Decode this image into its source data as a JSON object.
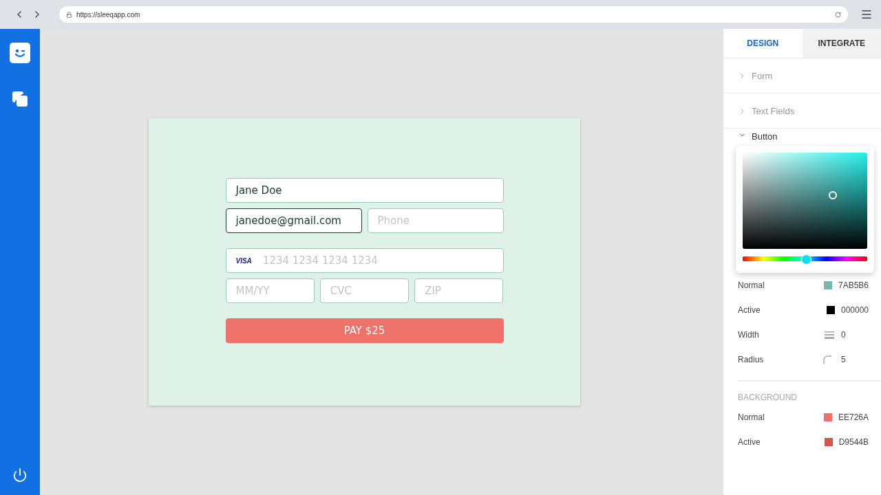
{
  "browser": {
    "url": "https://sleeqapp.com"
  },
  "form": {
    "rows": [
      [
        {
          "kind": "text",
          "value": "Jane Doe",
          "focused": false
        }
      ],
      [
        {
          "kind": "text",
          "value": "janedoe@gmail.com",
          "focused": true
        },
        {
          "kind": "text",
          "placeholder": "Phone",
          "focused": false
        }
      ],
      [
        {
          "kind": "card",
          "brand": "VISA",
          "placeholder": "1234 1234 1234 1234",
          "focused": false
        }
      ],
      [
        {
          "kind": "text",
          "placeholder": "MM/YY",
          "focused": false
        },
        {
          "kind": "text",
          "placeholder": "CVC",
          "focused": false
        },
        {
          "kind": "text",
          "placeholder": "ZIP",
          "focused": false
        }
      ]
    ],
    "pay_button": "PAY $25"
  },
  "panel": {
    "tabs": [
      {
        "label": "DESIGN",
        "selected": true
      },
      {
        "label": "INTEGRATE",
        "selected": false
      }
    ],
    "sections": [
      {
        "label": "Form",
        "expanded": false
      },
      {
        "label": "Text Fields",
        "expanded": false
      },
      {
        "label": "Button",
        "expanded": true
      }
    ],
    "picker": {
      "level": 0.5
    },
    "border_rows": [
      {
        "kind": "color",
        "label": "Normal",
        "value": "7AB5B6",
        "color": "#7ab5b6"
      },
      {
        "kind": "color",
        "label": "Active",
        "value": "000000",
        "color": "#000000"
      },
      {
        "kind": "width",
        "label": "Width",
        "value": "0"
      },
      {
        "kind": "radius",
        "label": "Radius",
        "value": "5"
      }
    ],
    "background_heading": "BACKGROUND",
    "background_rows": [
      {
        "kind": "color",
        "label": "Normal",
        "value": "EE726A",
        "color": "#ee726a"
      },
      {
        "kind": "color",
        "label": "Active",
        "value": "D9544B",
        "color": "#d9544b"
      }
    ]
  }
}
